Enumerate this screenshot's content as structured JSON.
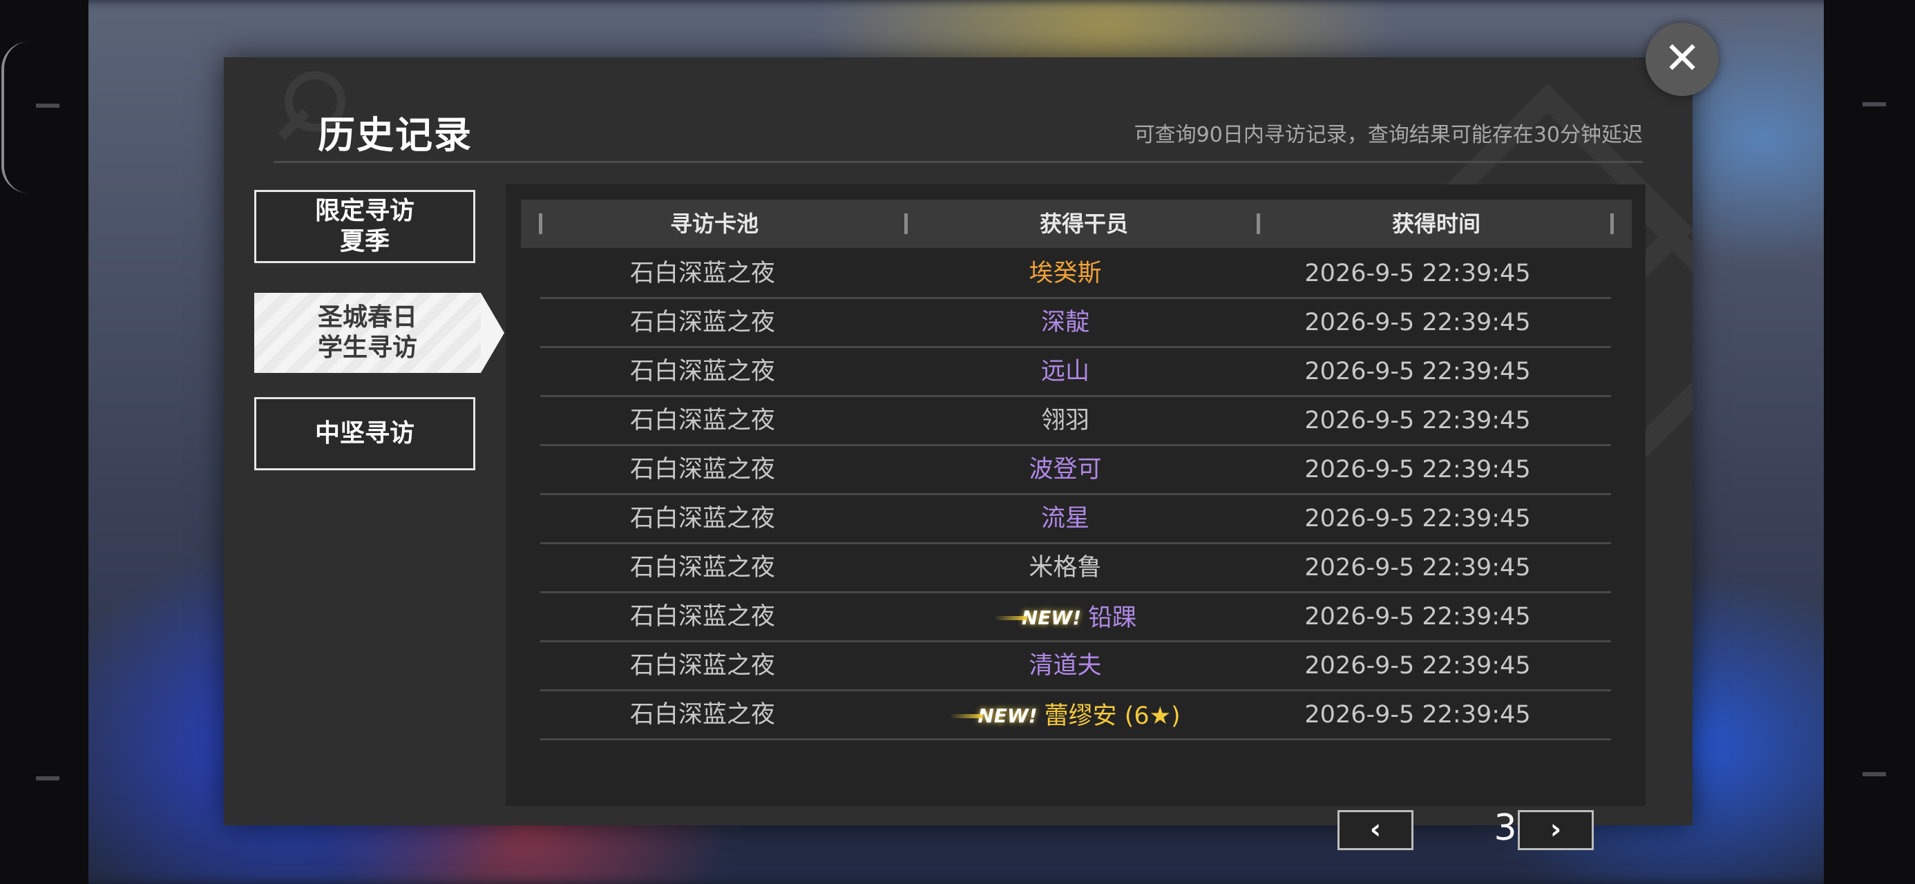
{
  "window": {
    "title": "历史记录",
    "subtitle": "可查询90日内寻访记录，查询结果可能存在30分钟延迟"
  },
  "tabs": [
    {
      "line1": "限定寻访",
      "line2": "夏季",
      "active": false
    },
    {
      "line1": "圣城春日",
      "line2": "学生寻访",
      "active": true
    },
    {
      "line1": "中坚寻访",
      "line2": "",
      "active": false
    }
  ],
  "table": {
    "headers": [
      "寻访卡池",
      "获得干员",
      "获得时间"
    ],
    "rows": [
      {
        "pool": "石白深蓝之夜",
        "operator": "埃癸斯",
        "color": "#f0a33a",
        "new": "",
        "time": "2026-9-5 22:39:45"
      },
      {
        "pool": "石白深蓝之夜",
        "operator": "深靛",
        "color": "#b089e6",
        "new": "",
        "time": "2026-9-5 22:39:45"
      },
      {
        "pool": "石白深蓝之夜",
        "operator": "远山",
        "color": "#b089e6",
        "new": "",
        "time": "2026-9-5 22:39:45"
      },
      {
        "pool": "石白深蓝之夜",
        "operator": "翎羽",
        "color": "#c8c8c8",
        "new": "",
        "time": "2026-9-5 22:39:45"
      },
      {
        "pool": "石白深蓝之夜",
        "operator": "波登可",
        "color": "#b089e6",
        "new": "",
        "time": "2026-9-5 22:39:45"
      },
      {
        "pool": "石白深蓝之夜",
        "operator": "流星",
        "color": "#b089e6",
        "new": "",
        "time": "2026-9-5 22:39:45"
      },
      {
        "pool": "石白深蓝之夜",
        "operator": "米格鲁",
        "color": "#c8c8c8",
        "new": "",
        "time": "2026-9-5 22:39:45"
      },
      {
        "pool": "石白深蓝之夜",
        "operator": "铅踝",
        "color": "#b089e6",
        "new": "NEW!",
        "time": "2026-9-5 22:39:45"
      },
      {
        "pool": "石白深蓝之夜",
        "operator": "清道夫",
        "color": "#b089e6",
        "new": "",
        "time": "2026-9-5 22:39:45"
      },
      {
        "pool": "石白深蓝之夜",
        "operator": "蕾缪安 (6★)",
        "color": "#f5c93c",
        "new": "NEW!",
        "time": "2026-9-5 22:39:45"
      }
    ]
  },
  "pager": {
    "prev_icon": "chevron-left-icon",
    "next_icon": "chevron-right-icon",
    "page": "3"
  },
  "close": {
    "icon": "close-icon"
  },
  "colors": {
    "six_star": "#f5c93c",
    "five_star": "#f0a33a",
    "four_star": "#b089e6",
    "three_star": "#c8c8c8"
  }
}
